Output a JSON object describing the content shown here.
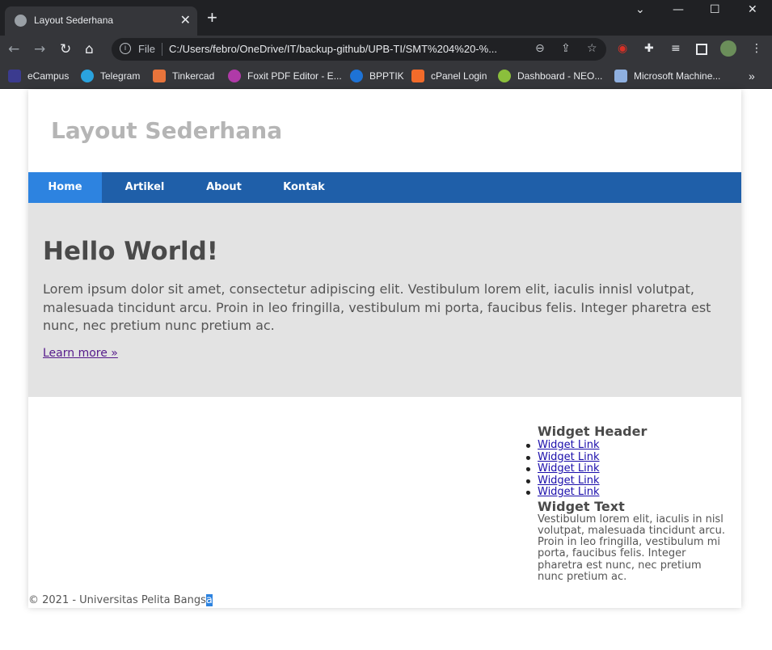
{
  "browser": {
    "tab_title": "Layout Sederhana",
    "tab_close": "✕",
    "new_tab": "+",
    "window_controls": [
      "⌄",
      "—",
      "☐",
      "✕"
    ],
    "file_label": "File",
    "url": "C:/Users/febro/OneDrive/IT/backup-github/UPB-TI/SMT%204%20-%...",
    "bookmarks": [
      {
        "label": "eCampus",
        "icon": "ecampus-icon",
        "color": "#3b3b8f"
      },
      {
        "label": "Telegram",
        "icon": "telegram-icon",
        "color": "#2aa3de"
      },
      {
        "label": "Tinkercad",
        "icon": "tinkercad-icon",
        "color": "#e8743b"
      },
      {
        "label": "Foxit PDF Editor - E...",
        "icon": "foxit-icon",
        "color": "#b03aa8"
      },
      {
        "label": "BPPTIK",
        "icon": "bpptik-icon",
        "color": "#1e73d6"
      },
      {
        "label": "cPanel Login",
        "icon": "cpanel-icon",
        "color": "#f26b2a"
      },
      {
        "label": "Dashboard - NEO...",
        "icon": "neo-icon",
        "color": "#8bbf3c"
      },
      {
        "label": "Microsoft Machine...",
        "icon": "flask-icon",
        "color": "#8fb0e0"
      }
    ],
    "more_bookmarks": "»"
  },
  "site": {
    "title": "Layout Sederhana",
    "nav": [
      "Home",
      "Artikel",
      "About",
      "Kontak"
    ],
    "hero_title": "Hello World!",
    "hero_text": "Lorem ipsum dolor sit amet, consectetur adipiscing elit. Vestibulum lorem elit, iaculis innisl volutpat, malesuada tincidunt arcu. Proin in leo fringilla, vestibulum mi porta, faucibus felis. Integer pharetra est nunc, nec pretium nunc pretium ac.",
    "hero_link": "Learn more »",
    "widget_header": "Widget Header",
    "widget_links": [
      "Widget Link",
      "Widget Link",
      "Widget Link",
      "Widget Link",
      "Widget Link"
    ],
    "widget_text_title": "Widget Text",
    "widget_text": "Vestibulum lorem elit, iaculis in nisl volutpat, malesuada tincidunt arcu. Proin in leo fringilla, vestibulum mi porta, faucibus felis. Integer pharetra est nunc, nec pretium nunc pretium ac.",
    "footer_main": "© 2021 - Universitas Pelita Bangs",
    "footer_selected": "a"
  },
  "colors": {
    "nav_bg": "#1f5fa9",
    "nav_active": "#2d83e0",
    "hero_bg": "#e3e3e3"
  }
}
